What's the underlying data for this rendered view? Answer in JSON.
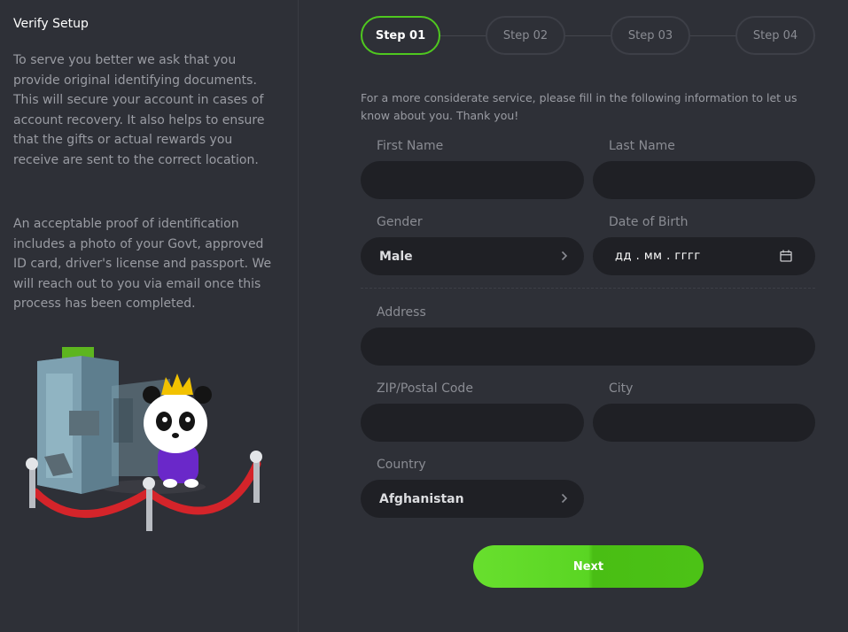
{
  "sidebar": {
    "title": "Verify Setup",
    "paragraph1": "To serve you better we ask that you provide original identifying documents. This will secure your account in cases of account recovery. It also helps to ensure that the gifts or actual rewards you receive are sent to the correct location.",
    "paragraph2": "An acceptable proof of identification includes a photo of your Govt, approved ID card, driver's license and passport. We will reach out to you via email once this process has been completed."
  },
  "steps": [
    "Step 01",
    "Step 02",
    "Step 03",
    "Step 04"
  ],
  "active_step": 1,
  "intro": "For a more considerate service, please fill in the following information to let us know about you. Thank you!",
  "form": {
    "first_name_label": "First Name",
    "first_name_value": "",
    "last_name_label": "Last Name",
    "last_name_value": "",
    "gender_label": "Gender",
    "gender_value": "Male",
    "dob_label": "Date of Birth",
    "dob_value": "дд . мм . гггг",
    "address_label": "Address",
    "address_value": "",
    "zip_label": "ZIP/Postal Code",
    "zip_value": "",
    "city_label": "City",
    "city_value": "",
    "country_label": "Country",
    "country_value": "Afghanistan"
  },
  "next_label": "Next",
  "colors": {
    "background": "#2e3037",
    "field": "#1f2025",
    "accent": "#4fc81f"
  }
}
